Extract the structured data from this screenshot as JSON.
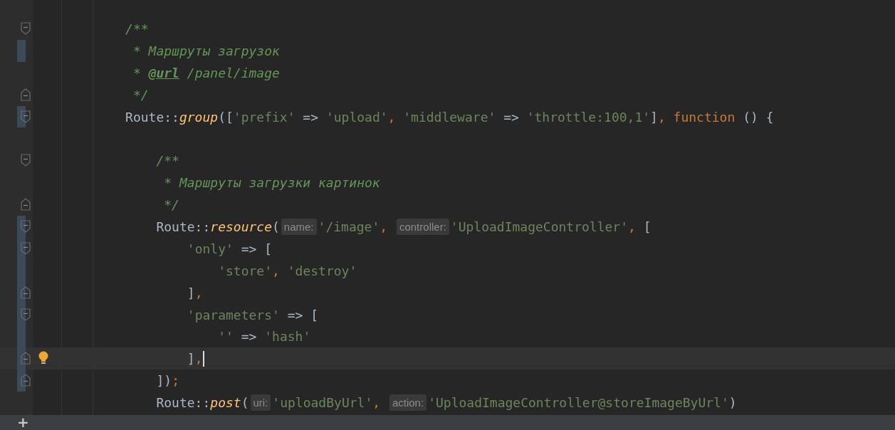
{
  "editor": {
    "lines": [
      {
        "fold_start": true,
        "fold_end": false,
        "changed": false,
        "current": false,
        "tokens": [
          {
            "kind": "comment",
            "text": "/**"
          }
        ]
      },
      {
        "fold_start": false,
        "fold_end": false,
        "changed": true,
        "current": false,
        "tokens": [
          {
            "kind": "comment",
            "text": " * Маршруты загрузок"
          }
        ]
      },
      {
        "fold_start": false,
        "fold_end": false,
        "changed": false,
        "current": false,
        "tokens": [
          {
            "kind": "comment",
            "text": " * "
          },
          {
            "kind": "doc-tag",
            "text": "@url"
          },
          {
            "kind": "comment",
            "text": " /panel/image"
          }
        ]
      },
      {
        "fold_start": false,
        "fold_end": true,
        "changed": false,
        "current": false,
        "tokens": [
          {
            "kind": "comment",
            "text": " */"
          }
        ]
      },
      {
        "fold_start": true,
        "fold_end": false,
        "changed": true,
        "current": false,
        "tokens": [
          {
            "kind": "plain",
            "text": "Route::"
          },
          {
            "kind": "method",
            "text": "group"
          },
          {
            "kind": "plain",
            "text": "(["
          },
          {
            "kind": "string",
            "text": "'prefix'"
          },
          {
            "kind": "plain",
            "text": " => "
          },
          {
            "kind": "string",
            "text": "'upload'"
          },
          {
            "kind": "punct",
            "text": ", "
          },
          {
            "kind": "string",
            "text": "'middleware'"
          },
          {
            "kind": "plain",
            "text": " => "
          },
          {
            "kind": "string",
            "text": "'throttle:100,1'"
          },
          {
            "kind": "plain",
            "text": "]"
          },
          {
            "kind": "punct",
            "text": ", "
          },
          {
            "kind": "keyword",
            "text": "function"
          },
          {
            "kind": "plain",
            "text": " () {"
          }
        ],
        "children": [
          {
            "fold_start": false,
            "fold_end": false,
            "changed": false,
            "current": false
          },
          {
            "fold_start": true,
            "fold_end": false,
            "changed": false,
            "current": false,
            "tokens": [
              {
                "kind": "comment",
                "text": "/**"
              }
            ]
          },
          {
            "fold_start": false,
            "fold_end": false,
            "changed": false,
            "current": false,
            "tokens": [
              {
                "kind": "comment",
                "text": " * Маршруты загрузки картинок"
              }
            ]
          },
          {
            "fold_start": false,
            "fold_end": true,
            "changed": false,
            "current": false,
            "tokens": [
              {
                "kind": "comment",
                "text": " */"
              }
            ]
          },
          {
            "fold_start": true,
            "fold_end": false,
            "changed": true,
            "current": false,
            "tokens": [
              {
                "kind": "plain",
                "text": "Route::"
              },
              {
                "kind": "method",
                "text": "resource"
              },
              {
                "kind": "plain",
                "text": "("
              },
              {
                "kind": "hint",
                "text": "name:"
              },
              {
                "kind": "string",
                "text": "'/image'"
              },
              {
                "kind": "punct",
                "text": ", "
              },
              {
                "kind": "hint",
                "text": "controller:"
              },
              {
                "kind": "string",
                "text": "'UploadImageController'"
              },
              {
                "kind": "punct",
                "text": ", "
              },
              {
                "kind": "plain",
                "text": "["
              }
            ],
            "children": [
              {
                "fold_start": true,
                "fold_end": false,
                "changed": true,
                "current": false,
                "tokens": [
                  {
                    "kind": "string",
                    "text": "'only'"
                  },
                  {
                    "kind": "plain",
                    "text": " => ["
                  }
                ],
                "children": [
                  {
                    "fold_start": false,
                    "fold_end": false,
                    "changed": true,
                    "current": false,
                    "tokens": [
                      {
                        "kind": "string",
                        "text": "'store'"
                      },
                      {
                        "kind": "punct",
                        "text": ", "
                      },
                      {
                        "kind": "string",
                        "text": "'destroy'"
                      }
                    ]
                  }
                ]
              },
              {
                "fold_start": false,
                "fold_end": true,
                "changed": true,
                "current": false,
                "tokens": [
                  {
                    "kind": "plain",
                    "text": "]"
                  },
                  {
                    "kind": "punct",
                    "text": ","
                  }
                ]
              },
              {
                "fold_start": true,
                "fold_end": false,
                "changed": true,
                "current": false,
                "tokens": [
                  {
                    "kind": "string",
                    "text": "'parameters'"
                  },
                  {
                    "kind": "plain",
                    "text": " => ["
                  }
                ],
                "children": [
                  {
                    "fold_start": false,
                    "fold_end": false,
                    "changed": true,
                    "current": false,
                    "tokens": [
                      {
                        "kind": "string",
                        "text": "''"
                      },
                      {
                        "kind": "plain",
                        "text": " => "
                      },
                      {
                        "kind": "string",
                        "text": "'hash'"
                      }
                    ]
                  }
                ]
              },
              {
                "fold_start": false,
                "fold_end": true,
                "changed": true,
                "current": true,
                "tokens": [
                  {
                    "kind": "plain",
                    "text": "]"
                  },
                  {
                    "kind": "punct",
                    "text": ","
                  }
                ]
              }
            ]
          },
          {
            "fold_start": false,
            "fold_end": true,
            "changed": true,
            "current": false,
            "tokens": [
              {
                "kind": "plain",
                "text": "])"
              },
              {
                "kind": "punct",
                "text": ";"
              }
            ]
          },
          {
            "fold_start": false,
            "fold_end": false,
            "changed": false,
            "current": false,
            "tokens": [
              {
                "kind": "plain",
                "text": "Route::"
              },
              {
                "kind": "method",
                "text": "post"
              },
              {
                "kind": "plain",
                "text": "("
              },
              {
                "kind": "hint",
                "text": "uri:"
              },
              {
                "kind": "string",
                "text": "'uploadByUrl'"
              },
              {
                "kind": "punct",
                "text": ", "
              },
              {
                "kind": "hint",
                "text": "action:"
              },
              {
                "kind": "string",
                "text": "'UploadImageController@storeImageByUrl'"
              },
              {
                "kind": "plain",
                "text": ")"
              }
            ]
          }
        ]
      }
    ]
  },
  "status_bar": {
    "add_button": "+"
  }
}
